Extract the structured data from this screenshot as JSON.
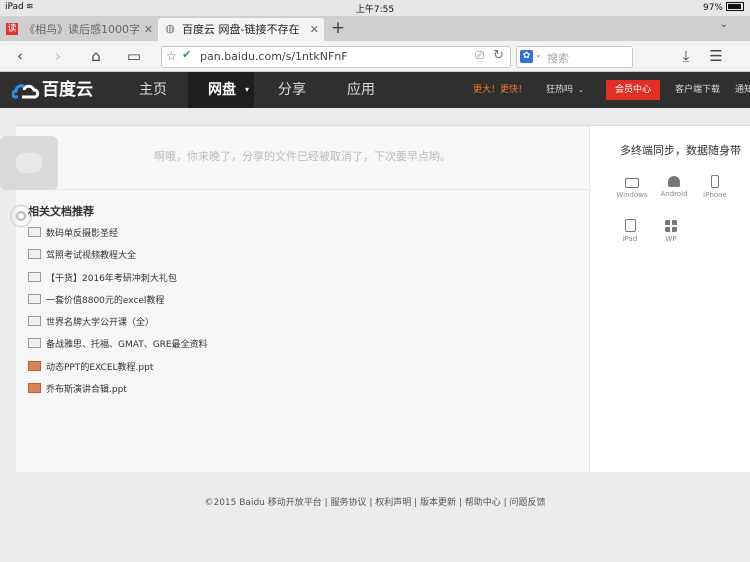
{
  "statusbar": {
    "device": "iPad",
    "time": "上午7:55",
    "battery": "97%"
  },
  "tabs": [
    {
      "title": "《相鸟》读后感1000字",
      "icon": "读"
    },
    {
      "title": "百度云 网盘-链接不存在"
    }
  ],
  "toolbar": {
    "url": "pan.baidu.com/s/1ntkNFnF",
    "search_placeholder": "搜索",
    "search_engine": "du"
  },
  "header": {
    "logo": "百度云",
    "nav": [
      "主页",
      "网盘",
      "分享",
      "应用"
    ],
    "promo": "更大！更快！",
    "hot": "狂热吗",
    "vip": "会员中心",
    "client": "客户端下载",
    "notify": "通知"
  },
  "main": {
    "message": "啊哦，你来晚了，分享的文件已经被取消了，下次要早点哟。",
    "related_title": "相关文档推荐",
    "docs": [
      {
        "name": "数码单反摄影圣经",
        "type": "doc"
      },
      {
        "name": "驾照考试视频教程大全",
        "type": "doc"
      },
      {
        "name": "【干货】2016年考研冲刺大礼包",
        "type": "doc"
      },
      {
        "name": "一套价值8800元的excel教程",
        "type": "doc"
      },
      {
        "name": "世界名牌大学公开课（全）",
        "type": "doc"
      },
      {
        "name": "备战雅思、托福、GMAT、GRE最全资料",
        "type": "doc"
      },
      {
        "name": "动态PPT的EXCEL教程.ppt",
        "type": "ppt"
      },
      {
        "name": "乔布斯演讲合辑.ppt",
        "type": "ppt"
      }
    ]
  },
  "sidebar": {
    "title": "多终端同步，数据随身带",
    "platforms": [
      "Windows",
      "Android",
      "iPhone",
      "iPad",
      "WP"
    ]
  },
  "footer": "©2015 Baidu 移动开放平台 | 服务协议 | 权利声明 | 版本更新 | 帮助中心 | 问题反馈"
}
